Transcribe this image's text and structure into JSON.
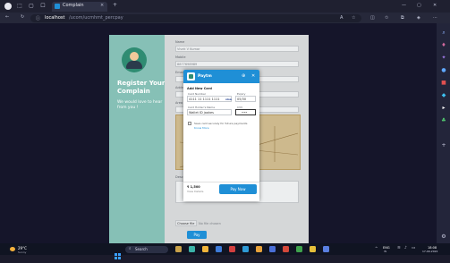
{
  "browser": {
    "tab_title": "Complain",
    "url_host": "localhost",
    "url_path": "/ucom/ucmhmt_percpay",
    "new_tab": "+",
    "close_tab": "×"
  },
  "left_panel": {
    "title": "Register Your Complain",
    "subtitle": "We would love to hear from you !"
  },
  "form": {
    "fields": [
      {
        "label": "Name",
        "value": "Vivek V Kumar"
      },
      {
        "label": "Mobile",
        "value": "8877698989"
      },
      {
        "label": "Email",
        "value": ""
      },
      {
        "label": "Address",
        "value": ""
      },
      {
        "label": "Area",
        "value": ""
      }
    ],
    "description_label": "Description",
    "choose_file_label": "Choose file",
    "file_status": "No file chosen",
    "submit_label": "Pay"
  },
  "payment": {
    "brand": "Paytm",
    "card_section_title": "Add New Card",
    "card_number_label": "Card Number",
    "card_number_value": "4111 11 1111 1111",
    "card_brand": "visa",
    "expiry_label": "Expiry",
    "expiry_value": "05/30",
    "holder_label": "Card Holder's Name",
    "holder_value": "Wallet ID jaakes",
    "cvv_label": "CVV",
    "cvv_value": "•••",
    "save_card_text": "Save card securely for future payments",
    "know_more": "Know More",
    "amount_value": "₹ 1,500",
    "amount_caption": "View Details",
    "pay_now_label": "Pay Now"
  },
  "taskbar": {
    "weather": "29°C",
    "weather_desc": "Sunny",
    "search_label": "Search",
    "lang": "ENG",
    "lang_sub": "IN",
    "time": "18:08",
    "date": "17-09-2022"
  },
  "colors": {
    "accent": "#1f8fd6",
    "left_panel": "#86c0b6",
    "avatar": "#2f8c72"
  }
}
